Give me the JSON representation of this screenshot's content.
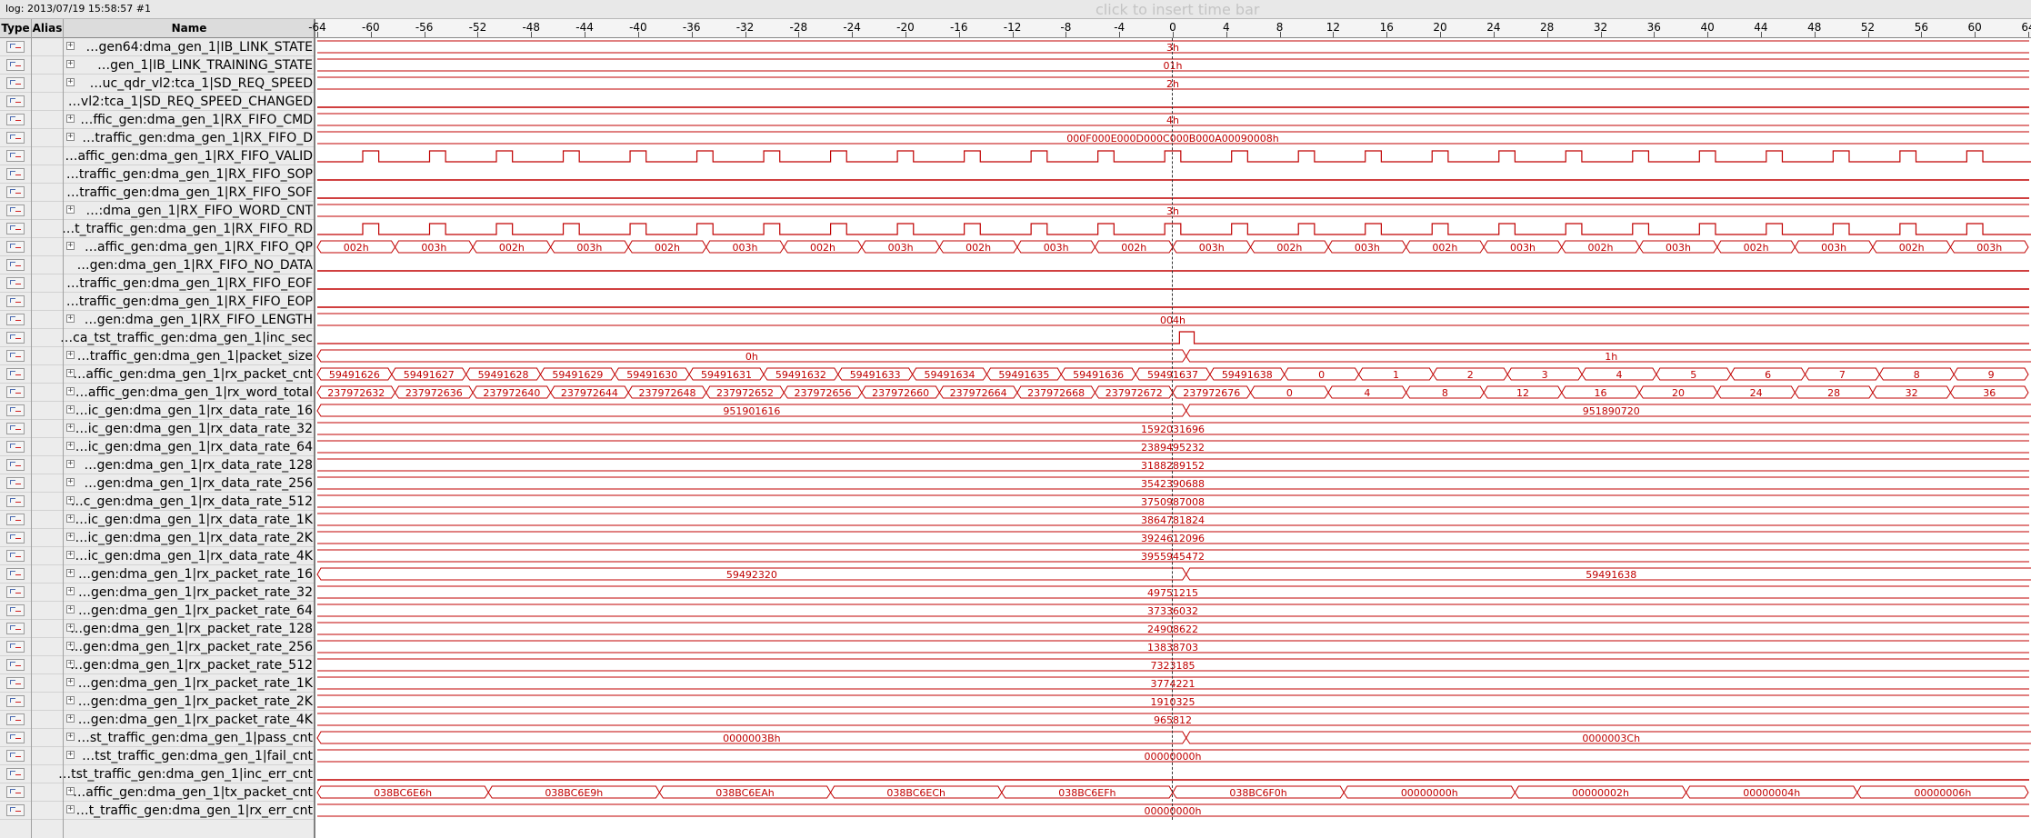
{
  "log": "log: 2013/07/19 15:58:57  #1",
  "insert_hint": "click to insert time bar",
  "headers": {
    "type": "Type",
    "alias": "Alias",
    "name": "Name"
  },
  "ruler": [
    "-64",
    "-60",
    "-56",
    "-52",
    "-48",
    "-44",
    "-40",
    "-36",
    "-32",
    "-28",
    "-24",
    "-20",
    "-16",
    "-12",
    "-8",
    "-4",
    "0",
    "4",
    "8",
    "12",
    "16",
    "20",
    "24",
    "28",
    "32",
    "36",
    "40",
    "44",
    "48",
    "52",
    "56",
    "60",
    "64"
  ],
  "signals": [
    {
      "name": "…gen64:dma_gen_1|IB_LINK_STATE",
      "bus": true,
      "type": "const",
      "label": "3h"
    },
    {
      "name": "…gen_1|IB_LINK_TRAINING_STATE",
      "bus": true,
      "type": "const",
      "label": "01h"
    },
    {
      "name": "…uc_qdr_vl2:tca_1|SD_REQ_SPEED",
      "bus": true,
      "type": "const",
      "label": "2h"
    },
    {
      "name": "…vl2:tca_1|SD_REQ_SPEED_CHANGED",
      "bus": false,
      "type": "low"
    },
    {
      "name": "…ffic_gen:dma_gen_1|RX_FIFO_CMD",
      "bus": true,
      "type": "const",
      "label": "4h"
    },
    {
      "name": "…traffic_gen:dma_gen_1|RX_FIFO_D",
      "bus": true,
      "type": "const",
      "label": "000F000E000D000C000B000A00090008h"
    },
    {
      "name": "…affic_gen:dma_gen_1|RX_FIFO_VALID",
      "bus": false,
      "type": "pulses"
    },
    {
      "name": "…traffic_gen:dma_gen_1|RX_FIFO_SOP",
      "bus": false,
      "type": "low"
    },
    {
      "name": "…traffic_gen:dma_gen_1|RX_FIFO_SOF",
      "bus": false,
      "type": "low"
    },
    {
      "name": "…:dma_gen_1|RX_FIFO_WORD_CNT",
      "bus": true,
      "type": "const",
      "label": "3h"
    },
    {
      "name": "…t_traffic_gen:dma_gen_1|RX_FIFO_RD",
      "bus": false,
      "type": "pulses"
    },
    {
      "name": "…affic_gen:dma_gen_1|RX_FIFO_QP",
      "bus": true,
      "type": "bus",
      "segs": [
        [
          "002h",
          0
        ],
        [
          "003h",
          1
        ],
        [
          "002h",
          2
        ],
        [
          "003h",
          3
        ],
        [
          "002h",
          4
        ],
        [
          "003h",
          5
        ],
        [
          "002h",
          6
        ],
        [
          "003h",
          7
        ],
        [
          "002h",
          8
        ],
        [
          "003h",
          9
        ],
        [
          "002h",
          10
        ],
        [
          "003h",
          11
        ],
        [
          "002h",
          12
        ],
        [
          "003h",
          13
        ],
        [
          "002h",
          14
        ],
        [
          "003h",
          15
        ],
        [
          "002h",
          16
        ],
        [
          "003h",
          17
        ],
        [
          "002h",
          18
        ],
        [
          "003h",
          19
        ],
        [
          "002h",
          20
        ],
        [
          "003h",
          25
        ]
      ]
    },
    {
      "name": "…gen:dma_gen_1|RX_FIFO_NO_DATA",
      "bus": false,
      "type": "low"
    },
    {
      "name": "…traffic_gen:dma_gen_1|RX_FIFO_EOF",
      "bus": false,
      "type": "low"
    },
    {
      "name": "…traffic_gen:dma_gen_1|RX_FIFO_EOP",
      "bus": false,
      "type": "low"
    },
    {
      "name": "…gen:dma_gen_1|RX_FIFO_LENGTH",
      "bus": true,
      "type": "const",
      "label": "004h"
    },
    {
      "name": "…ca_tst_traffic_gen:dma_gen_1|inc_sec",
      "bus": false,
      "type": "step"
    },
    {
      "name": "…traffic_gen:dma_gen_1|packet_size",
      "bus": true,
      "type": "two",
      "labels": [
        "0h",
        "1h"
      ]
    },
    {
      "name": "…affic_gen:dma_gen_1|rx_packet_cnt",
      "bus": true,
      "type": "bus",
      "segs": [
        [
          "59491626",
          0
        ],
        [
          "59491627",
          1
        ],
        [
          "59491628",
          2
        ],
        [
          "59491629",
          3
        ],
        [
          "59491630",
          4
        ],
        [
          "59491631",
          5
        ],
        [
          "59491632",
          6
        ],
        [
          "59491633",
          7
        ],
        [
          "59491634",
          8
        ],
        [
          "59491635",
          9
        ],
        [
          "59491636",
          10
        ],
        [
          "59491637",
          11
        ],
        [
          "59491638",
          12
        ],
        [
          "0",
          13
        ],
        [
          "1",
          14
        ],
        [
          "2",
          15
        ],
        [
          "3",
          16
        ],
        [
          "4",
          17
        ],
        [
          "5",
          18
        ],
        [
          "6",
          19
        ],
        [
          "7",
          20
        ],
        [
          "8",
          21
        ],
        [
          "9",
          22
        ]
      ]
    },
    {
      "name": "…affic_gen:dma_gen_1|rx_word_total",
      "bus": true,
      "type": "bus",
      "segs": [
        [
          "237972632",
          0
        ],
        [
          "237972636",
          1
        ],
        [
          "237972640",
          2
        ],
        [
          "237972644",
          3
        ],
        [
          "237972648",
          4
        ],
        [
          "237972652",
          5
        ],
        [
          "237972656",
          6
        ],
        [
          "237972660",
          7
        ],
        [
          "237972664",
          8
        ],
        [
          "237972668",
          9
        ],
        [
          "237972672",
          10
        ],
        [
          "237972676",
          11
        ],
        [
          "0",
          12
        ],
        [
          "4",
          13
        ],
        [
          "8",
          14
        ],
        [
          "12",
          15
        ],
        [
          "16",
          16
        ],
        [
          "20",
          17
        ],
        [
          "24",
          18
        ],
        [
          "28",
          19
        ],
        [
          "32",
          20
        ],
        [
          "36",
          21
        ]
      ]
    },
    {
      "name": "…ic_gen:dma_gen_1|rx_data_rate_16",
      "bus": true,
      "type": "two",
      "labels": [
        "951901616",
        "951890720"
      ]
    },
    {
      "name": "…ic_gen:dma_gen_1|rx_data_rate_32",
      "bus": true,
      "type": "const",
      "label": "1592031696"
    },
    {
      "name": "…ic_gen:dma_gen_1|rx_data_rate_64",
      "bus": true,
      "type": "const",
      "label": "2389495232"
    },
    {
      "name": "…gen:dma_gen_1|rx_data_rate_128",
      "bus": true,
      "type": "const",
      "label": "3188289152"
    },
    {
      "name": "…gen:dma_gen_1|rx_data_rate_256",
      "bus": true,
      "type": "const",
      "label": "3542390688"
    },
    {
      "name": "…c_gen:dma_gen_1|rx_data_rate_512",
      "bus": true,
      "type": "const",
      "label": "3750987008"
    },
    {
      "name": "…ic_gen:dma_gen_1|rx_data_rate_1K",
      "bus": true,
      "type": "const",
      "label": "3864781824"
    },
    {
      "name": "…ic_gen:dma_gen_1|rx_data_rate_2K",
      "bus": true,
      "type": "const",
      "label": "3924612096"
    },
    {
      "name": "…ic_gen:dma_gen_1|rx_data_rate_4K",
      "bus": true,
      "type": "const",
      "label": "3955945472"
    },
    {
      "name": "…gen:dma_gen_1|rx_packet_rate_16",
      "bus": true,
      "type": "two",
      "labels": [
        "59492320",
        "59491638"
      ]
    },
    {
      "name": "…gen:dma_gen_1|rx_packet_rate_32",
      "bus": true,
      "type": "const",
      "label": "49751215"
    },
    {
      "name": "…gen:dma_gen_1|rx_packet_rate_64",
      "bus": true,
      "type": "const",
      "label": "37336032"
    },
    {
      "name": "…gen:dma_gen_1|rx_packet_rate_128",
      "bus": true,
      "type": "const",
      "label": "24908622"
    },
    {
      "name": "…gen:dma_gen_1|rx_packet_rate_256",
      "bus": true,
      "type": "const",
      "label": "13838703"
    },
    {
      "name": "…gen:dma_gen_1|rx_packet_rate_512",
      "bus": true,
      "type": "const",
      "label": "7323185"
    },
    {
      "name": "…gen:dma_gen_1|rx_packet_rate_1K",
      "bus": true,
      "type": "const",
      "label": "3774221"
    },
    {
      "name": "…gen:dma_gen_1|rx_packet_rate_2K",
      "bus": true,
      "type": "const",
      "label": "1910325"
    },
    {
      "name": "…gen:dma_gen_1|rx_packet_rate_4K",
      "bus": true,
      "type": "const",
      "label": "965812"
    },
    {
      "name": "…st_traffic_gen:dma_gen_1|pass_cnt",
      "bus": true,
      "type": "two",
      "labels": [
        "0000003Bh",
        "0000003Ch"
      ]
    },
    {
      "name": "…tst_traffic_gen:dma_gen_1|fail_cnt",
      "bus": true,
      "type": "const",
      "label": "00000000h"
    },
    {
      "name": "…tst_traffic_gen:dma_gen_1|inc_err_cnt",
      "bus": false,
      "type": "low"
    },
    {
      "name": "…affic_gen:dma_gen_1|tx_packet_cnt",
      "bus": true,
      "type": "bus",
      "segs": [
        [
          "038BC6E6h",
          0
        ],
        [
          "038BC6E9h",
          3
        ],
        [
          "038BC6EAh",
          4
        ],
        [
          "038BC6ECh",
          6
        ],
        [
          "038BC6EFh",
          8
        ],
        [
          "038BC6F0h",
          9
        ],
        [
          "00000000h",
          10
        ],
        [
          "00000002h",
          12
        ],
        [
          "00000004h",
          14
        ],
        [
          "00000006h",
          16
        ]
      ]
    },
    {
      "name": "…t_traffic_gen:dma_gen_1|rx_err_cnt",
      "bus": true,
      "type": "const",
      "label": "00000000h"
    }
  ]
}
